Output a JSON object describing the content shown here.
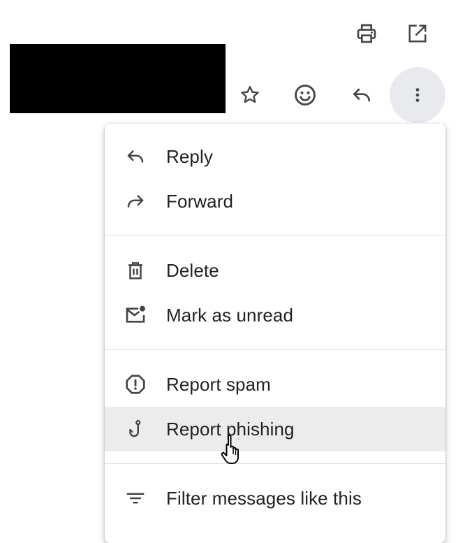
{
  "toolbar": {
    "top_icons": [
      "print-icon",
      "open-in-new-window-icon"
    ],
    "row_icons": [
      "star-icon",
      "emoji-icon",
      "reply-icon",
      "more-vert-icon"
    ]
  },
  "menu": {
    "groups": [
      [
        {
          "label": "Reply",
          "icon": "reply-icon"
        },
        {
          "label": "Forward",
          "icon": "forward-icon"
        }
      ],
      [
        {
          "label": "Delete",
          "icon": "trash-icon"
        },
        {
          "label": "Mark as unread",
          "icon": "mark-unread-icon"
        }
      ],
      [
        {
          "label": "Report spam",
          "icon": "report-spam-icon"
        },
        {
          "label": "Report phishing",
          "icon": "phishing-hook-icon",
          "hovered": true
        }
      ],
      [
        {
          "label": "Filter messages like this",
          "icon": "filter-icon"
        }
      ]
    ]
  },
  "colors": {
    "icon": "#444746",
    "text": "#202124",
    "hover_bg": "#ececec",
    "divider": "#dadce0",
    "more_button_bg": "#e8eaed"
  }
}
